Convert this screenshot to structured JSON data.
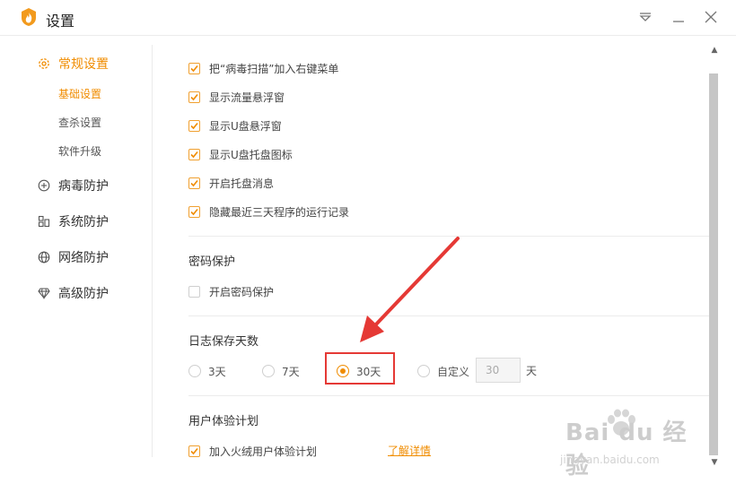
{
  "window": {
    "title": "设置",
    "controls": [
      "menu-icon",
      "minimize-icon",
      "close-icon"
    ]
  },
  "sidebar": {
    "groups": [
      {
        "label": "常规设置",
        "icon": "gear-icon",
        "active": true
      },
      {
        "label": "病毒防护",
        "icon": "plus-square-icon"
      },
      {
        "label": "系统防护",
        "icon": "grid-icon"
      },
      {
        "label": "网络防护",
        "icon": "globe-icon"
      },
      {
        "label": "高级防护",
        "icon": "diamond-icon"
      }
    ],
    "sub_items": [
      {
        "label": "基础设置",
        "active": true
      },
      {
        "label": "查杀设置"
      },
      {
        "label": "软件升级"
      }
    ]
  },
  "general_options": [
    {
      "label": "把“病毒扫描”加入右键菜单",
      "checked": true
    },
    {
      "label": "显示流量悬浮窗",
      "checked": true
    },
    {
      "label": "显示U盘悬浮窗",
      "checked": true
    },
    {
      "label": "显示U盘托盘图标",
      "checked": true
    },
    {
      "label": "开启托盘消息",
      "checked": true
    },
    {
      "label": "隐藏最近三天程序的运行记录",
      "checked": true
    }
  ],
  "password": {
    "title": "密码保护",
    "option": {
      "label": "开启密码保护",
      "checked": false
    }
  },
  "log_days": {
    "title": "日志保存天数",
    "options": [
      {
        "label": "3天",
        "selected": false
      },
      {
        "label": "7天",
        "selected": false
      },
      {
        "label": "30天",
        "selected": true
      },
      {
        "label": "自定义",
        "selected": false
      }
    ],
    "custom_value": "30",
    "unit": "天"
  },
  "ux_plan": {
    "title": "用户体验计划",
    "option": {
      "label": "加入火绒用户体验计划",
      "checked": true
    },
    "link": "了解详情"
  },
  "watermark": {
    "main": "Bai du 经验",
    "sub": "jingyan.baidu.com"
  },
  "colors": {
    "accent": "#f08c00",
    "annotation": "#e53935"
  }
}
